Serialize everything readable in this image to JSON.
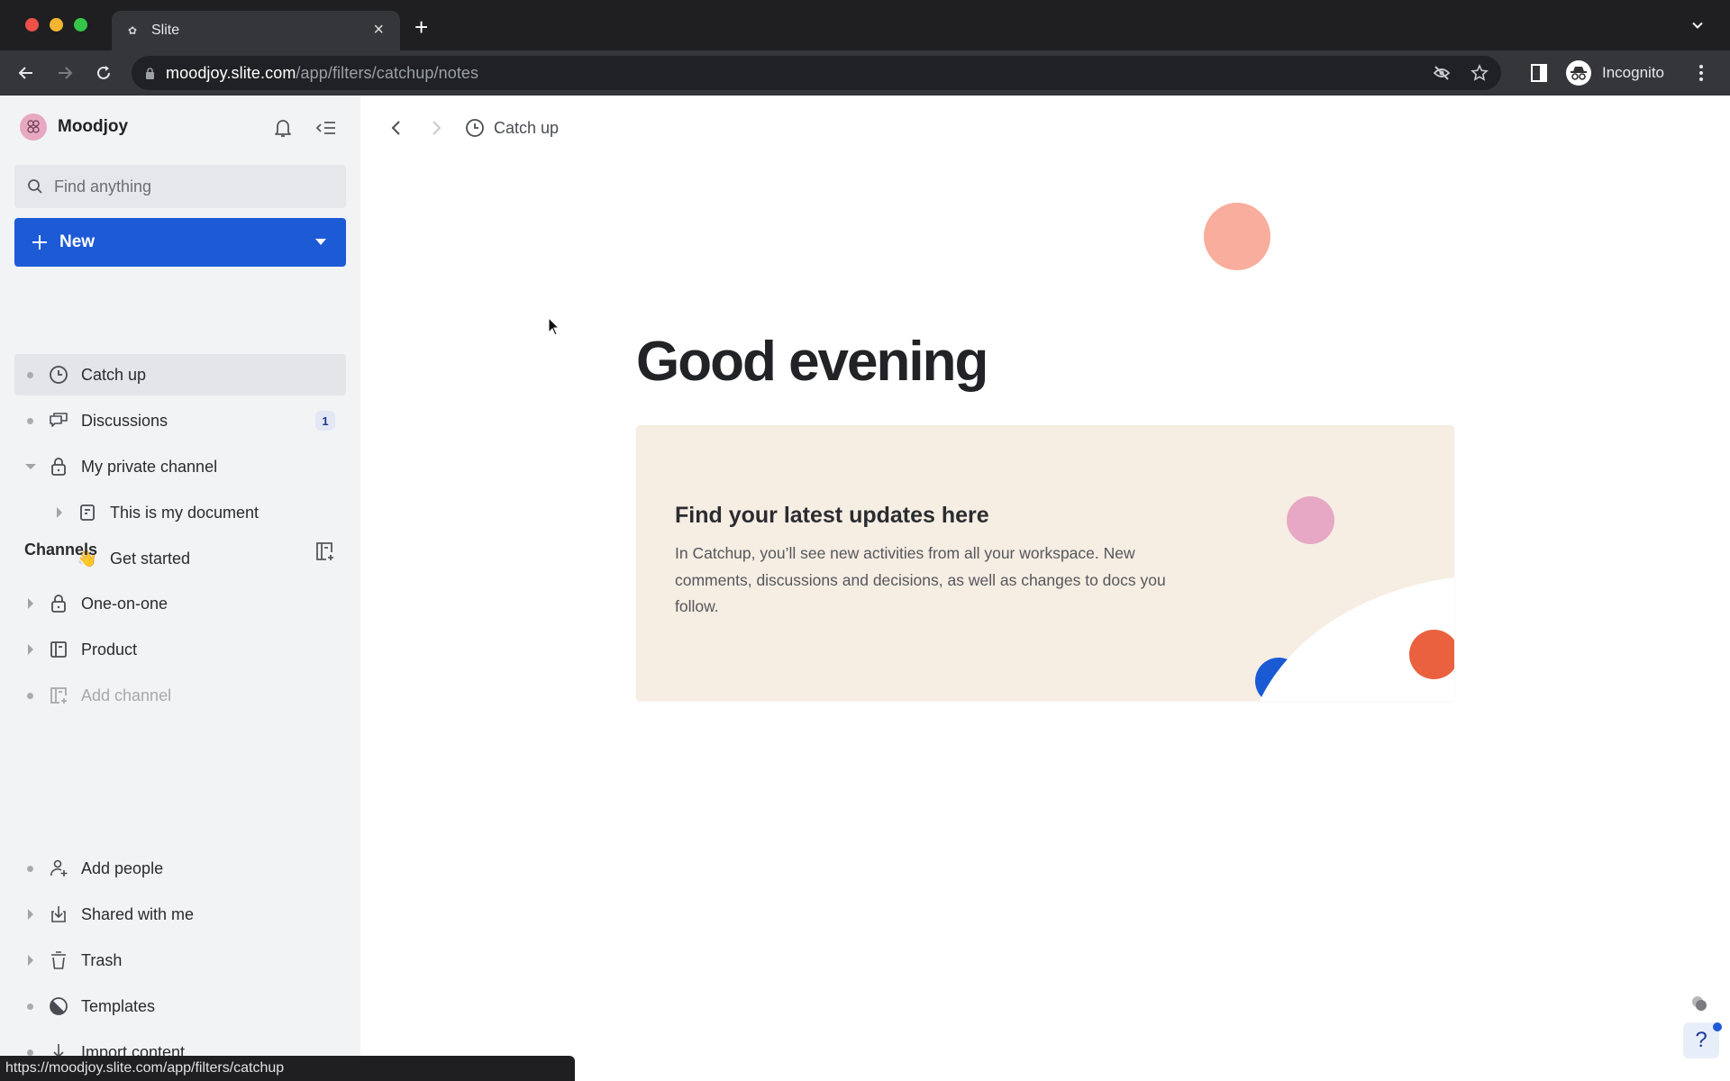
{
  "browser": {
    "tab_title": "Slite",
    "url_host": "moodjoy.slite.com",
    "url_path": "/app/filters/catchup/notes",
    "profile_label": "Incognito",
    "status_url": "https://moodjoy.slite.com/app/filters/catchup"
  },
  "sidebar": {
    "workspace_name": "Moodjoy",
    "search_placeholder": "Find anything",
    "new_button_label": "New",
    "items": [
      {
        "label": "Catch up",
        "icon": "clock-icon",
        "active": true
      },
      {
        "label": "Discussions",
        "icon": "chat-bubbles-icon",
        "badge": "1"
      },
      {
        "label": "My private channel",
        "icon": "lock-icon",
        "expanded": true
      },
      {
        "label": "This is my document",
        "icon": "document-icon"
      },
      {
        "label": "Get started",
        "icon": "👋"
      }
    ],
    "channels_title": "Channels",
    "channels": [
      {
        "label": "One-on-one",
        "icon": "lock-icon"
      },
      {
        "label": "Product",
        "icon": "channel-icon"
      },
      {
        "label": "Add channel",
        "icon": "add-channel-icon"
      }
    ],
    "bottom_items": [
      {
        "label": "Add people",
        "icon": "add-person-icon"
      },
      {
        "label": "Shared with me",
        "icon": "inbox-download-icon"
      },
      {
        "label": "Trash",
        "icon": "trash-icon"
      },
      {
        "label": "Templates",
        "icon": "templates-icon"
      },
      {
        "label": "Import content",
        "icon": "import-icon"
      }
    ]
  },
  "main": {
    "breadcrumb_label": "Catch up",
    "greeting": "Good evening",
    "card": {
      "title": "Find your latest updates here",
      "body": "In Catchup, you’ll see new activities from all your workspace. New comments, discussions and decisions, as well as changes to docs you follow."
    },
    "help_label": "?"
  },
  "colors": {
    "accent": "#1d5ad6",
    "card_bg": "#f6ede3",
    "peach": "#f9ad9c",
    "pink": "#e6a8c4",
    "orange": "#e9613f"
  }
}
